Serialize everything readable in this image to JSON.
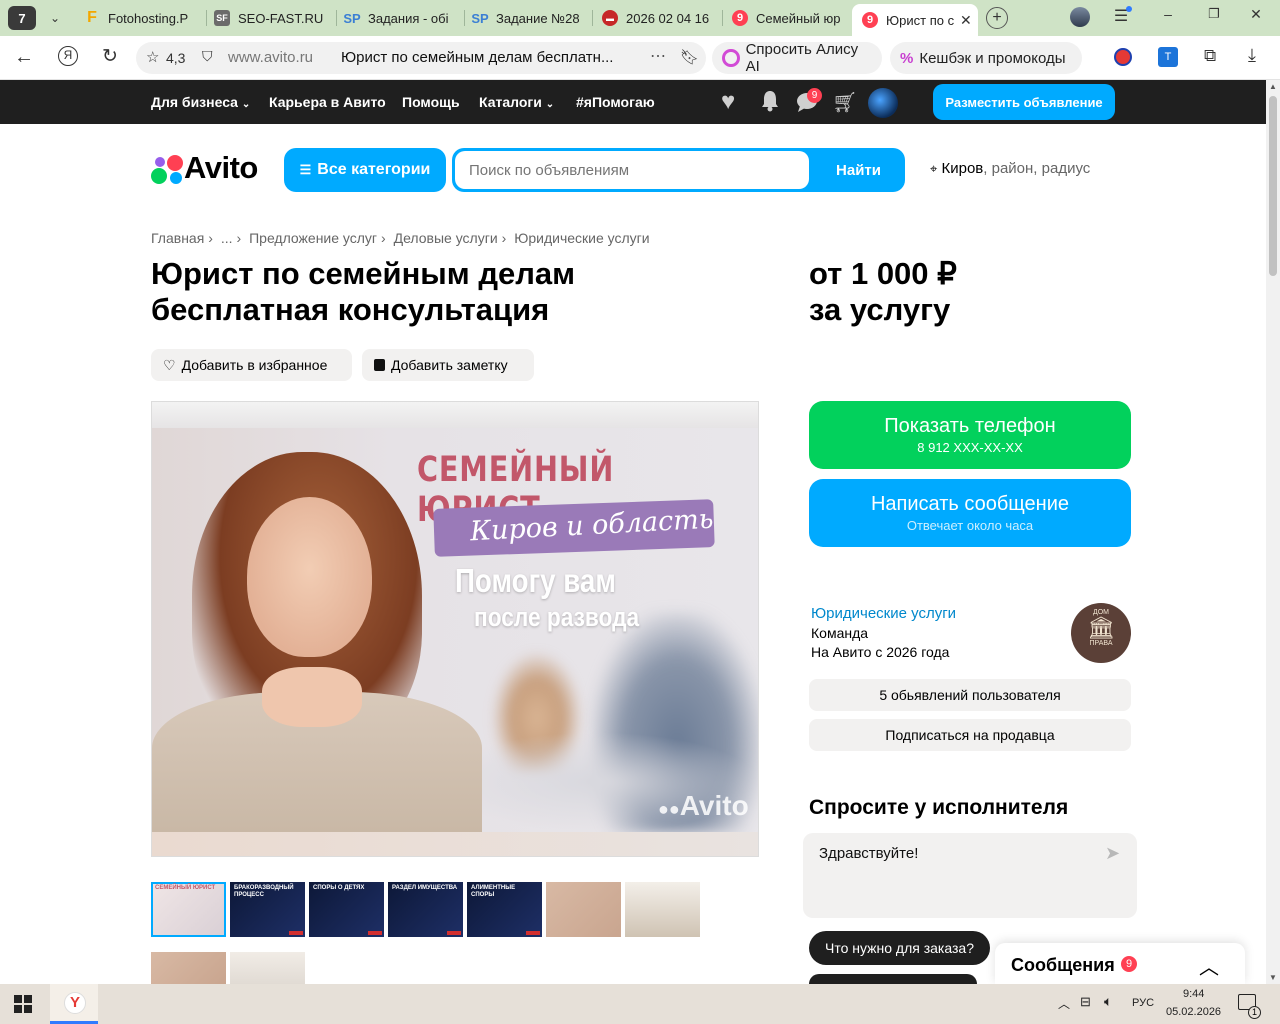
{
  "browser": {
    "tab_count": "7",
    "tabs": [
      {
        "label": "Fotohosting.P",
        "icon": "F"
      },
      {
        "label": "SEO-FAST.RU",
        "icon": "SF"
      },
      {
        "label": "Задания - обі",
        "icon": "SP"
      },
      {
        "label": "Задание №28",
        "icon": "SP"
      },
      {
        "label": "2026 02 04 16",
        "icon": "▬"
      },
      {
        "label": "Семейный юр",
        "icon": "9"
      },
      {
        "label": "Юрист по с",
        "icon": "9"
      }
    ],
    "rating": "4,3",
    "url_domain": "www.avito.ru",
    "page_title": "Юрист по семейным делам бесплатн...",
    "alice_label": "Спросить Алису AI",
    "cashback_label": "Кешбэк и промокоды"
  },
  "topnav": {
    "items": [
      "Для бизнеса",
      "Карьера в Авито",
      "Помощь",
      "Каталоги",
      "#яПомогаю"
    ],
    "messages_badge": "9",
    "post_button": "Разместить объявление"
  },
  "header": {
    "logo": "Avito",
    "categories_button": "Все категории",
    "search_placeholder": "Поиск по объявлениям",
    "search_button": "Найти",
    "location_city": "Киров",
    "location_rest": ", район, радиус"
  },
  "breadcrumbs": [
    "Главная",
    "...",
    "Предложение услуг",
    "Деловые услуги",
    "Юридические услуги"
  ],
  "listing": {
    "title_line1": "Юрист по семейным делам",
    "title_line2": "бесплатная консультация",
    "price_line1": "от 1 000 ₽",
    "price_line2": "за услугу",
    "favorite_button": "Добавить в избранное",
    "note_button": "Добавить заметку"
  },
  "photo": {
    "heading": "СЕМЕЙНЫЙ ЮРИСТ",
    "region": "Киров и область",
    "line1": "Помогу вам",
    "line2": "после развода",
    "watermark": "Avito"
  },
  "thumbnails": [
    {
      "caption": "СЕМЕЙНЫЙ ЮРИСТ",
      "theme": "light"
    },
    {
      "caption": "БРАКОРАЗВОДНЫЙ ПРОЦЕСС",
      "theme": "dark"
    },
    {
      "caption": "СПОРЫ О ДЕТЯХ",
      "theme": "dark"
    },
    {
      "caption": "РАЗДЕЛ ИМУЩЕСТВА",
      "theme": "dark"
    },
    {
      "caption": "АЛИМЕНТНЫЕ СПОРЫ",
      "theme": "dark"
    },
    {
      "caption": "",
      "theme": "beige"
    },
    {
      "caption": "",
      "theme": "office"
    },
    {
      "caption": "",
      "theme": "beige"
    },
    {
      "caption": "",
      "theme": "pale"
    }
  ],
  "contact": {
    "phone_button": "Показать телефон",
    "phone_number": "8 912 XXX-XX-XX",
    "message_button": "Написать сообщение",
    "message_sub": "Отвечает около часа"
  },
  "seller": {
    "category_link": "Юридические услуги",
    "type": "Команда",
    "since": "На Авито с 2026 года",
    "avatar_top": "ДОМ",
    "avatar_bottom": "ПРАВА",
    "listings_button": "5 обьявлений пользователя",
    "subscribe_button": "Подписаться на продавца"
  },
  "ask": {
    "heading": "Спросите у исполнителя",
    "message_value": "Здравствуйте!",
    "chips": [
      "Что нужно для заказа?",
      ""
    ]
  },
  "messages_panel": {
    "label": "Сообщения",
    "badge": "9"
  },
  "taskbar": {
    "lang": "РУС",
    "time": "9:44",
    "date": "05.02.2026",
    "notifications": "1"
  },
  "colors": {
    "avito_blue": "#00aaff",
    "avito_green": "#02d15c",
    "dark_bar": "#1f1f1f",
    "badge_red": "#ff4053",
    "link_blue": "#0088cc",
    "tab_bg": "#cfe3c6"
  }
}
